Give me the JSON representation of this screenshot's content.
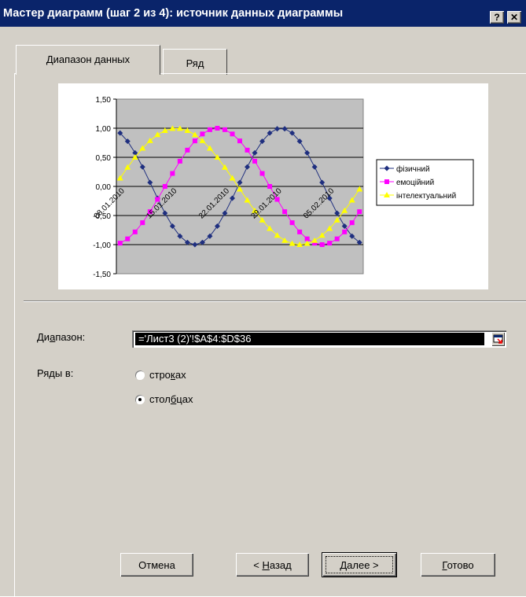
{
  "window": {
    "title": "Мастер диаграмм (шаг 2 из 4): источник данных диаграммы",
    "help_label": "?",
    "close_label": "✕"
  },
  "tabs": [
    {
      "label": "Диапазон данных",
      "active": true
    },
    {
      "label": "Ряд",
      "active": false
    }
  ],
  "range": {
    "label_pre": "Ди",
    "label_u": "а",
    "label_post": "пазон:",
    "value": "='Лист3 (2)'!$A$4:$D$36"
  },
  "series_in": {
    "label": "Ряды в:",
    "rows": {
      "pre": "стро",
      "u": "к",
      "post": "ах",
      "checked": false
    },
    "cols": {
      "pre": "стол",
      "u": "б",
      "post": "цах",
      "checked": true
    }
  },
  "buttons": {
    "cancel": "Отмена",
    "back": {
      "pre": "< ",
      "u": "Н",
      "post": "азад"
    },
    "next": {
      "pre": "",
      "u": "Д",
      "post": "алее >"
    },
    "finish": {
      "pre": "",
      "u": "Г",
      "post": "отово"
    }
  },
  "chart_data": {
    "type": "line",
    "y_ticks": [
      "1,50",
      "1,00",
      "0,50",
      "0,00",
      "-0,50",
      "-1,00",
      "-1,50"
    ],
    "ylim": [
      -1.5,
      1.5
    ],
    "x_tick_labels": [
      "08.01.2010",
      "15.01.2010",
      "22.01.2010",
      "29.01.2010",
      "05.02.2010"
    ],
    "point_count": 33,
    "series": [
      {
        "name": "фізичний",
        "color": "#1f2f7f",
        "marker": "diamond",
        "period": 23,
        "phase_day": 19.75
      },
      {
        "name": "емоційний",
        "color": "#ff00ff",
        "marker": "square",
        "period": 28,
        "phase_day": 10
      },
      {
        "name": "інтелектуальний",
        "color": "#ffff00",
        "marker": "triangle",
        "period": 33,
        "phase_day": 3.25
      }
    ]
  }
}
